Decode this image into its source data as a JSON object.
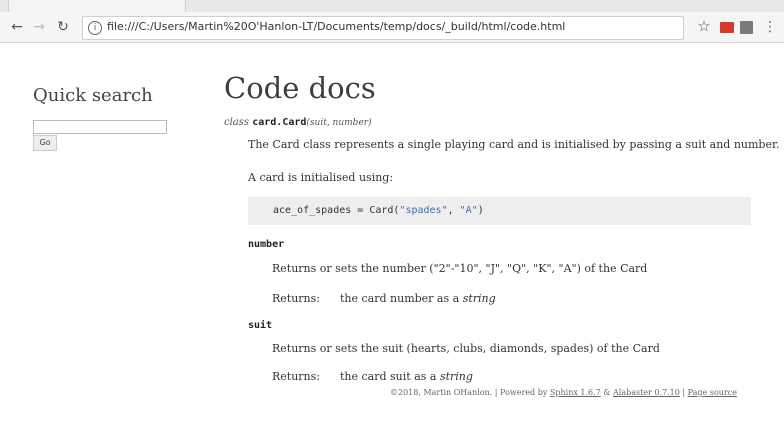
{
  "browser": {
    "url": "file:///C:/Users/Martin%20O'Hanlon-LT/Documents/temp/docs/_build/html/code.html",
    "icons": {
      "back": "arrow-left",
      "forward": "arrow-right",
      "reload": "reload",
      "info": "info",
      "star": "star",
      "menu": "vertical-dots"
    },
    "colors": {
      "ext1": "#d33a2c",
      "ext2": "#7a7a7a"
    }
  },
  "sidebar": {
    "heading": "Quick search",
    "search_value": "",
    "go_label": "Go"
  },
  "main": {
    "title": "Code docs",
    "signature": {
      "prefix": "class",
      "name": "card.Card",
      "params": "(suit, number)"
    },
    "description": "The Card class represents a single playing card and is initialised by passing a suit and number.",
    "init_text": "A card is initialised using:",
    "code": {
      "before": "ace_of_spades = Card(",
      "arg1": "\"spades\"",
      "sep": ", ",
      "arg2": "\"A\"",
      "after": ")"
    },
    "attributes": [
      {
        "name": "number",
        "description": "Returns or sets the number (\"2\"-\"10\", \"J\", \"Q\", \"K\", \"A\") of the Card",
        "returns_label": "Returns:",
        "returns_text": "the card number as a",
        "returns_type": "string"
      },
      {
        "name": "suit",
        "description": "Returns or sets the suit (hearts, clubs, diamonds, spades) of the Card",
        "returns_label": "Returns:",
        "returns_text": "the card suit as a",
        "returns_type": "string"
      }
    ]
  },
  "footer": {
    "copyright": "©2018, Martin OHanlon.",
    "sep1": " | Powered by ",
    "sphinx": "Sphinx 1.6.7",
    "amp": " & ",
    "alabaster": "Alabaster 0.7.10",
    "sep2": " | ",
    "page_source": "Page source"
  }
}
